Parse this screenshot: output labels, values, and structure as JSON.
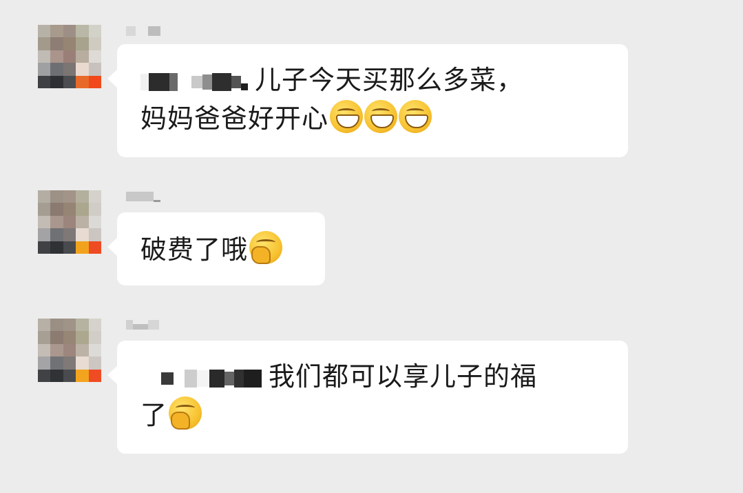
{
  "messages": [
    {
      "text": "儿子今天买那么多菜，",
      "text_line2": "妈妈爸爸好开心",
      "emoji_icons": [
        "grinning-face-icon",
        "grinning-face-icon",
        "grinning-face-icon"
      ]
    },
    {
      "text": "破费了哦",
      "emoji_icons": [
        "face-with-hand-over-mouth-icon"
      ]
    },
    {
      "text": "我们都可以享儿子的福",
      "text_line2": "了",
      "emoji_icons": [
        "face-with-hand-over-mouth-icon"
      ]
    }
  ],
  "colors": {
    "background": "#ececec",
    "bubble": "#ffffff",
    "text": "#1a1a1a"
  }
}
